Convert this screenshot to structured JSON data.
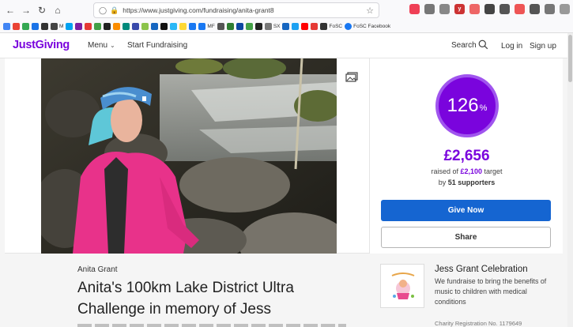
{
  "browser": {
    "url": "https://www.justgiving.com/fundraising/anita-grant8",
    "bookmarks": [
      "M",
      "MF",
      "SX",
      "FoSC",
      "FoSC Facebook"
    ]
  },
  "header": {
    "logo": "JustGiving",
    "menu_label": "Menu",
    "start_fundraising": "Start Fundraising",
    "search_label": "Search",
    "login_label": "Log in",
    "signup_label": "Sign up"
  },
  "stats": {
    "percent": "126",
    "percent_sign": "%",
    "raised": "£2,656",
    "target_prefix": "raised of ",
    "target_amount": "£2,100",
    "target_suffix": " target",
    "supporters_prefix": "by ",
    "supporters_count": "51 supporters",
    "percent_value": 126
  },
  "actions": {
    "give_now": "Give Now",
    "share": "Share"
  },
  "page": {
    "fundraiser_name": "Anita Grant",
    "title_line1": "Anita's 100km Lake District Ultra",
    "title_line2": "Challenge in memory of Jess"
  },
  "charity": {
    "name": "Jess Grant Celebration",
    "description": "We fundraise to bring the benefits of music to children with medical conditions",
    "registration": "Charity Registration No. 1179649"
  },
  "colors": {
    "brand_purple": "#7a04dd",
    "give_blue": "#1565d1"
  }
}
